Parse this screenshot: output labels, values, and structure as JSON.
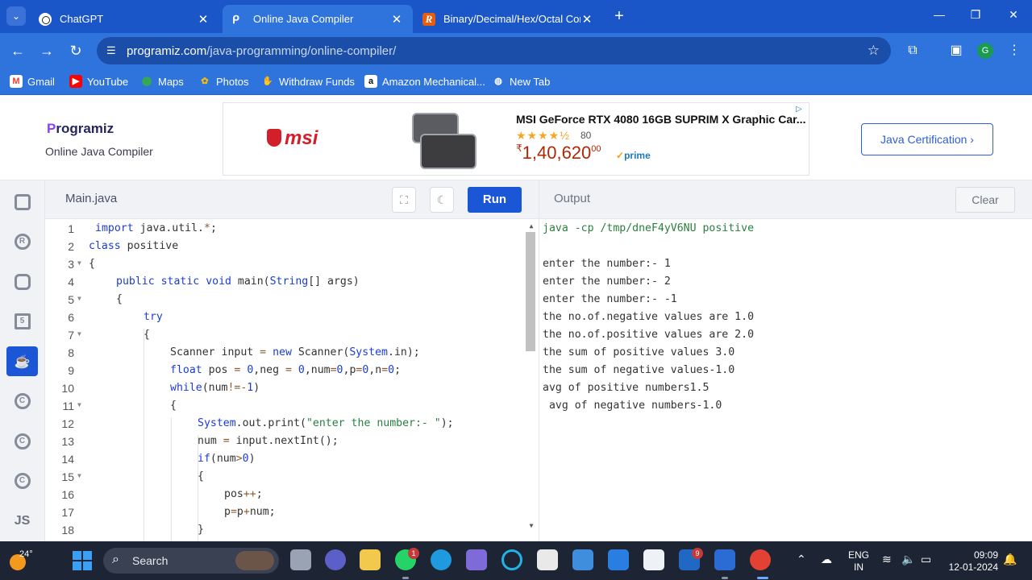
{
  "browser": {
    "tabs": [
      {
        "title": "ChatGPT",
        "icon": "chatgpt-icon"
      },
      {
        "title": "Online Java Compiler",
        "icon": "programiz-icon"
      },
      {
        "title": "Binary/Decimal/Hex/Octal Conv",
        "icon": "r-icon"
      }
    ],
    "url_domain": "programiz.com",
    "url_path": "/java-programming/online-compiler/",
    "profile_initial": "G",
    "bookmarks": [
      "Gmail",
      "YouTube",
      "Maps",
      "Photos",
      "Withdraw Funds",
      "Amazon Mechanical...",
      "New Tab"
    ]
  },
  "header": {
    "logo_p": "P",
    "logo_rest": "rogramiz",
    "subtitle": "Online Java Compiler",
    "cert_button": "Java Certification ›"
  },
  "ad": {
    "brand": "msi",
    "title": "MSI GeForce RTX 4080 16GB SUPRIM X Graphic Car...",
    "stars": "★★★★½",
    "rating_count": "80",
    "price_symbol": "₹",
    "price": "1,40,620",
    "price_decimal": "00",
    "prime": "prime"
  },
  "editor": {
    "filename": "Main.java",
    "run_label": "Run",
    "line_numbers": [
      "1",
      "2",
      "3",
      "4",
      "5",
      "6",
      "7",
      "8",
      "9",
      "10",
      "11",
      "12",
      "13",
      "14",
      "15",
      "16",
      "17",
      "18"
    ]
  },
  "output": {
    "label": "Output",
    "clear_label": "Clear",
    "lines": [
      "java -cp /tmp/dneF4yV6NU positive",
      "",
      "enter the number:- 1",
      "enter the number:- 2",
      "enter the number:- -1",
      "the no.of.negative values are 1.0",
      "the no.of.positive values are 2.0",
      "the sum of positive values 3.0",
      "the sum of negative values-1.0",
      "avg of positive numbers1.5",
      " avg of negative numbers-1.0"
    ]
  },
  "rail": {
    "js_label": "JS"
  },
  "taskbar": {
    "temperature": "24°",
    "search_label": "Search",
    "whatsapp_badge": "1",
    "teams_badge": "9",
    "lang_line1": "ENG",
    "lang_line2": "IN",
    "time": "09:09",
    "date": "12-01-2024"
  },
  "colors": {
    "chrome_blue": "#2f73dd",
    "run_blue": "#1a56d6",
    "keyword": "#1a3dd6",
    "string": "#2a7f3e"
  }
}
